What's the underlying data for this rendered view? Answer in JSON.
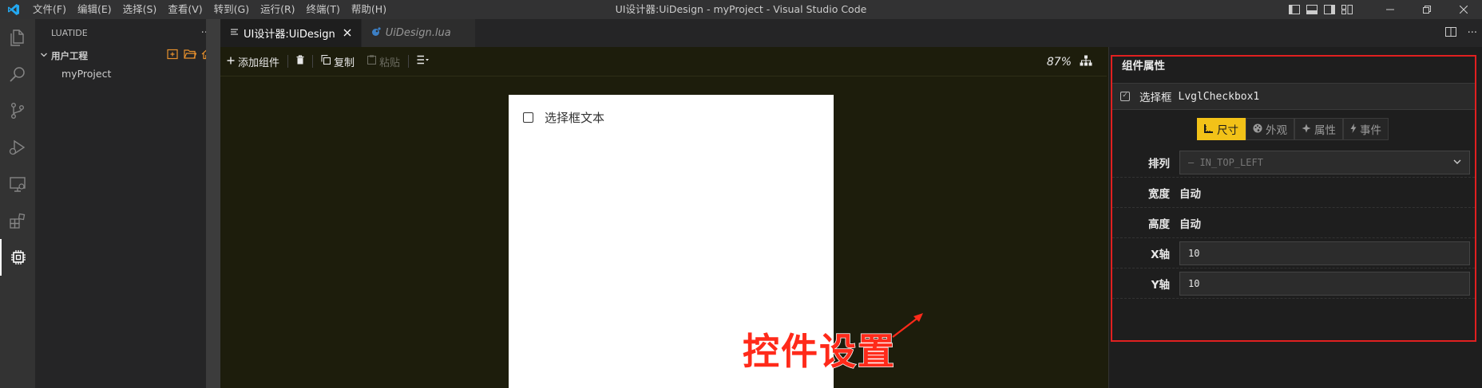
{
  "titlebar": {
    "menu": [
      "文件(F)",
      "编辑(E)",
      "选择(S)",
      "查看(V)",
      "转到(G)",
      "运行(R)",
      "终端(T)",
      "帮助(H)"
    ],
    "window_title": "UI设计器:UiDesign - myProject - Visual Studio Code"
  },
  "activitybar": {
    "icons": [
      "files-icon",
      "search-icon",
      "source-control-icon",
      "run-debug-icon",
      "remote-explorer-icon",
      "extensions-icon",
      "luatide-chip-icon"
    ]
  },
  "sidebar": {
    "header": "LUATIDE",
    "more": "···",
    "section": "用户工程",
    "items": [
      "myProject"
    ]
  },
  "tabs": [
    {
      "label": "UI设计器:UiDesign",
      "active": true
    },
    {
      "label": "UiDesign.lua",
      "active": false
    }
  ],
  "toolbar": {
    "add_component": "添加组件",
    "copy": "复制",
    "paste": "粘贴",
    "zoom": "87%"
  },
  "canvas": {
    "checkbox_text": "选择框文本"
  },
  "panel": {
    "title": "组件属性",
    "component_type": "选择框",
    "component_name": "LvglCheckbox1",
    "tabs": [
      {
        "label": "尺寸",
        "active": true
      },
      {
        "label": "外观",
        "active": false
      },
      {
        "label": "属性",
        "active": false
      },
      {
        "label": "事件",
        "active": false
      }
    ],
    "props": {
      "align_label": "排列",
      "align_value": "— IN_TOP_LEFT",
      "width_label": "宽度",
      "width_value": "自动",
      "height_label": "高度",
      "height_value": "自动",
      "x_label": "X轴",
      "x_value": "10",
      "y_label": "Y轴",
      "y_value": "10"
    }
  },
  "annotation": {
    "text": "控件设置",
    "color": "#ff2a1a"
  },
  "colors": {
    "accent_yellow": "#f2c218",
    "highlight_red": "#e12020",
    "designer_bg": "#1d1d0c"
  }
}
